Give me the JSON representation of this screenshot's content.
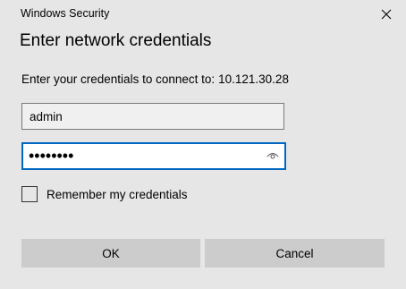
{
  "window": {
    "title": "Windows Security"
  },
  "dialog": {
    "heading": "Enter network credentials",
    "prompt_label": "Enter your credentials to connect to:",
    "host": "10.121.30.28"
  },
  "fields": {
    "username_value": "admin",
    "password_masked": "••••••••"
  },
  "remember": {
    "label": "Remember my credentials",
    "checked": false
  },
  "buttons": {
    "ok": "OK",
    "cancel": "Cancel"
  },
  "icons": {
    "close": "close-icon",
    "reveal_password": "eye-icon"
  },
  "colors": {
    "background": "#e6e6e6",
    "focus_border": "#0067c0",
    "button": "#cccccc"
  }
}
